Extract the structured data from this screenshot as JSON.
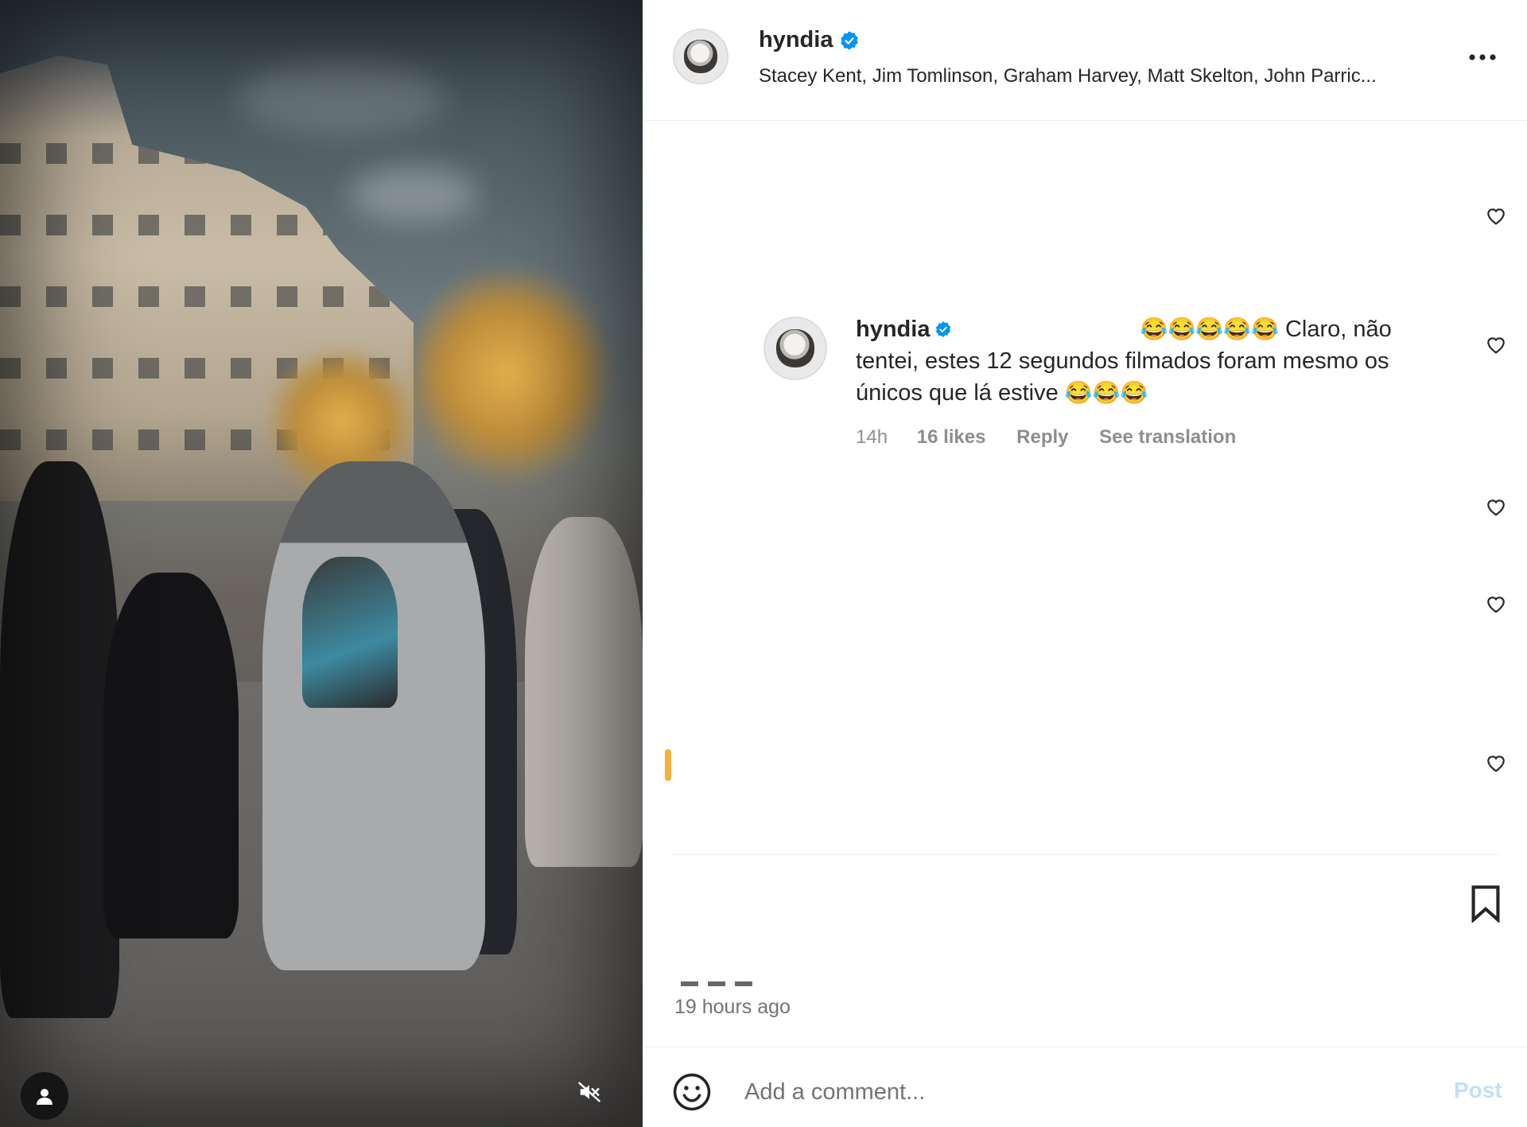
{
  "media": {
    "icons": {
      "user_tag": "user-silhouette-icon",
      "mute": "speaker-muted-icon"
    }
  },
  "header": {
    "username": "hyndia",
    "verified_icon": "verified-badge-icon",
    "audio": "Stacey Kent, Jim Tomlinson, Graham Harvey, Matt Skelton, John Parric...",
    "more_icon": "more-horizontal-icon"
  },
  "comment": {
    "username": "hyndia",
    "emoji_lead": "😂😂😂😂😂",
    "text": " Claro, não tentei, estes 12 segundos filmados foram mesmo os únicos que lá estive ",
    "emoji_tail": "😂😂😂",
    "time": "14h",
    "likes": "16 likes",
    "reply": "Reply",
    "see_translation": "See translation"
  },
  "actions": {
    "bookmark_icon": "bookmark-icon",
    "timestamp": "19 hours ago"
  },
  "composer": {
    "emoji_icon": "smiley-icon",
    "placeholder": "Add a comment...",
    "post_label": "Post"
  },
  "colors": {
    "verified": "#0095f6",
    "post_disabled": "#c0dffd",
    "muted_text": "#8e8e8e"
  }
}
